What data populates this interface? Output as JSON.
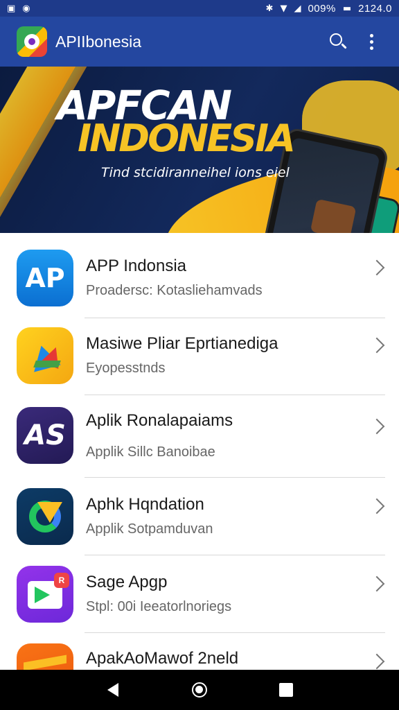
{
  "status_bar": {
    "left_icons": [
      "notification-icon",
      "app-icon"
    ],
    "battery": "009%",
    "time": "2124.0"
  },
  "app_bar": {
    "title": "APIIbonesia",
    "icons": [
      "search-icon",
      "more-vert-icon"
    ]
  },
  "banner": {
    "headline_line1": "APFCAN",
    "headline_line2": "INDONESIA",
    "tagline": "Tind stcidiranneihel ions eiel"
  },
  "apps": [
    {
      "name": "APP Indonsia",
      "subtitle": "Proadersc: Kotasliehamvads",
      "icon": "ap-icon",
      "icon_text": "AP"
    },
    {
      "name": "Masiwe Pliar Eprtianediga",
      "subtitle": "Eyopesstnds",
      "icon": "drive-icon"
    },
    {
      "name": "Aplik Ronalapaiams",
      "subtitle": "Applik Sillc Banoibae",
      "icon": "as-icon",
      "icon_text": "AS"
    },
    {
      "name": "Aphk Hqndation",
      "subtitle": "Applik Sotpamduvan",
      "icon": "ring-icon"
    },
    {
      "name": "Sage Apgp",
      "subtitle": "Stpl: 00i Ieeatorlnoriegs",
      "icon": "share-icon",
      "icon_badge": "R"
    },
    {
      "name": "ApakAoMawof 2neld",
      "subtitle": "",
      "icon": "orange-icon"
    }
  ],
  "colors": {
    "app_bar": "#2447a0",
    "status_bar": "#1e3a8a",
    "banner_accent": "#f6c325"
  },
  "nav_bar": {
    "icons": [
      "back-icon",
      "home-icon",
      "recents-icon"
    ]
  }
}
